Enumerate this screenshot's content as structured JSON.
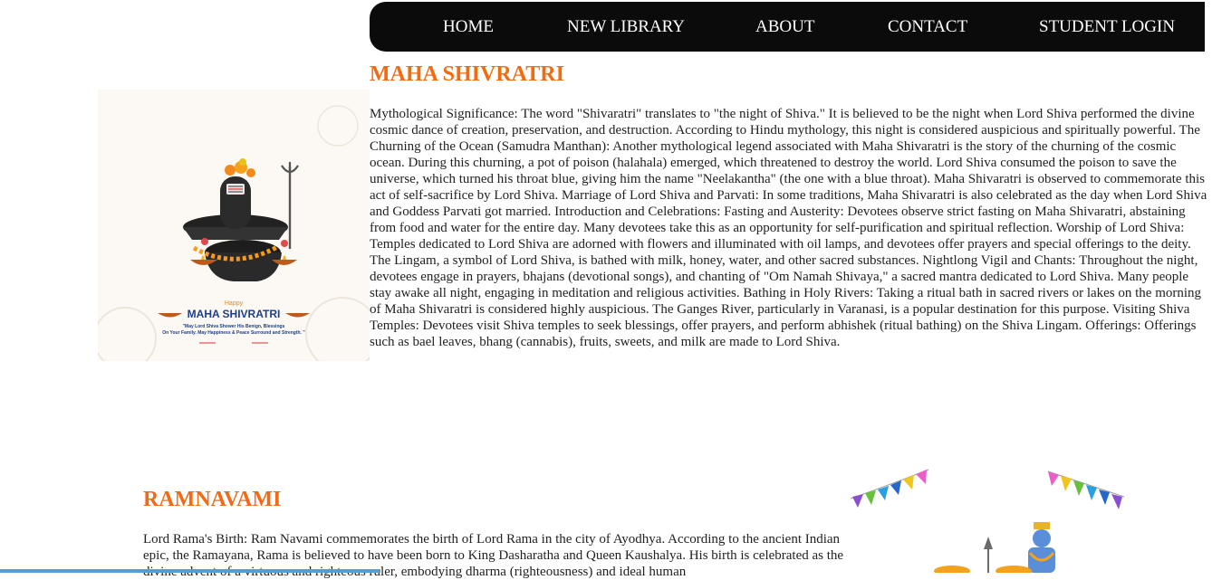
{
  "nav": {
    "items": [
      {
        "label": "HOME"
      },
      {
        "label": "NEW LIBRARY"
      },
      {
        "label": "ABOUT"
      },
      {
        "label": "CONTACT"
      },
      {
        "label": "STUDENT LOGIN"
      }
    ]
  },
  "sections": {
    "shivratri": {
      "title": "MAHA SHIVRATRI",
      "body": "Mythological Significance: The word \"Shivaratri\" translates to \"the night of Shiva.\" It is believed to be the night when Lord Shiva performed the divine cosmic dance of creation, preservation, and destruction. According to Hindu mythology, this night is considered auspicious and spiritually powerful. The Churning of the Ocean (Samudra Manthan): Another mythological legend associated with Maha Shivaratri is the story of the churning of the cosmic ocean. During this churning, a pot of poison (halahala) emerged, which threatened to destroy the world. Lord Shiva consumed the poison to save the universe, which turned his throat blue, giving him the name \"Neelakantha\" (the one with a blue throat). Maha Shivaratri is observed to commemorate this act of self-sacrifice by Lord Shiva. Marriage of Lord Shiva and Parvati: In some traditions, Maha Shivaratri is also celebrated as the day when Lord Shiva and Goddess Parvati got married. Introduction and Celebrations: Fasting and Austerity: Devotees observe strict fasting on Maha Shivaratri, abstaining from food and water for the entire day. Many devotees take this as an opportunity for self-purification and spiritual reflection. Worship of Lord Shiva: Temples dedicated to Lord Shiva are adorned with flowers and illuminated with oil lamps, and devotees offer prayers and special offerings to the deity. The Lingam, a symbol of Lord Shiva, is bathed with milk, honey, water, and other sacred substances. Nightlong Vigil and Chants: Throughout the night, devotees engage in prayers, bhajans (devotional songs), and chanting of \"Om Namah Shivaya,\" a sacred mantra dedicated to Lord Shiva. Many people stay awake all night, engaging in meditation and religious activities. Bathing in Holy Rivers: Taking a ritual bath in sacred rivers or lakes on the morning of Maha Shivaratri is considered highly auspicious. The Ganges River, particularly in Varanasi, is a popular destination for this purpose. Visiting Shiva Temples: Devotees visit Shiva temples to seek blessings, offer prayers, and perform abhishek (ritual bathing) on the Shiva Lingam. Offerings: Offerings such as bael leaves, bhang (cannabis), fruits, sweets, and milk are made to Lord Shiva.",
      "image": {
        "happy": "Happy",
        "title": "MAHA SHIVRATRI",
        "line1": "\"May Lord Shiva Shower His Benign, Blessings",
        "line2": "On Your Family. May Happiness & Peace Surround and Strength. \""
      }
    },
    "ramnavami": {
      "title": "RAMNAVAMI",
      "body": "Lord Rama's Birth: Ram Navami commemorates the birth of Lord Rama in the city of Ayodhya. According to the ancient Indian epic, the Ramayana, Rama is believed to have been born to King Dasharatha and Queen Kaushalya. His birth is celebrated as the divine advent of a virtuous and righteous ruler, embodying dharma (righteousness) and ideal human"
    }
  },
  "colors": {
    "accent": "#f36a12",
    "nav_bg": "#0b0b0b",
    "image_title": "#1b3f8a"
  }
}
